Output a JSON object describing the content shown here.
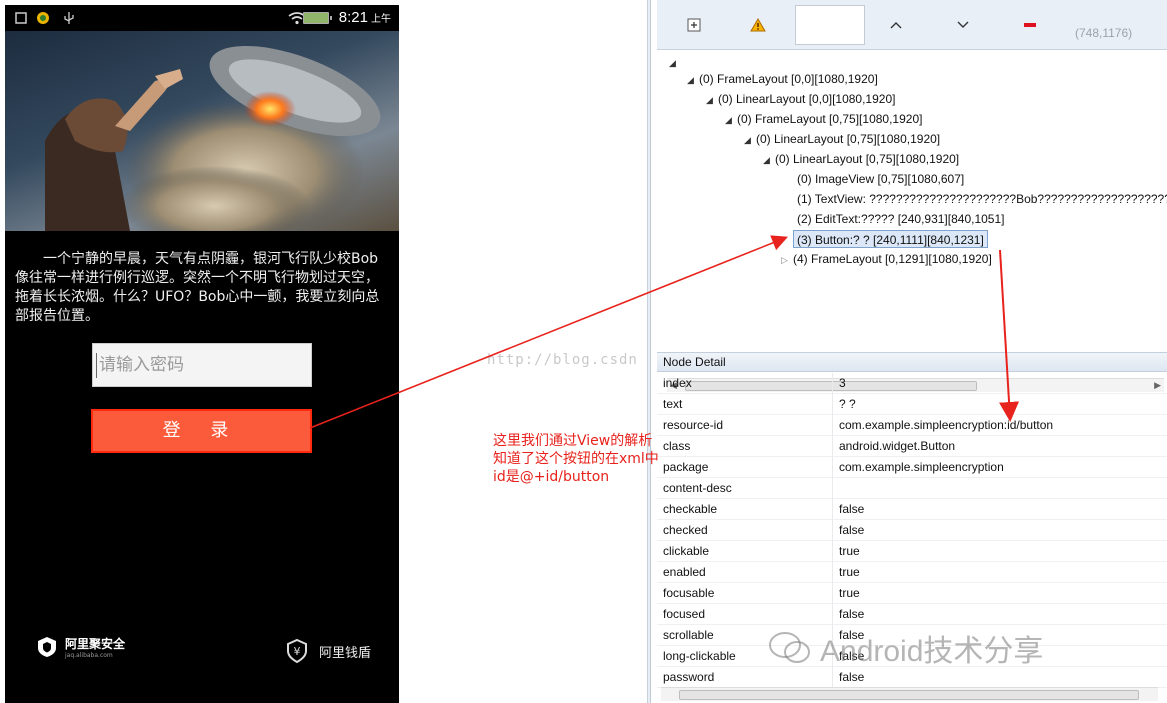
{
  "phone": {
    "status": {
      "time": "8:21",
      "ampm": "上午"
    },
    "story": "一个宁静的早晨，天气有点阴霾，银河飞行队少校Bob像往常一样进行例行巡逻。突然一个不明飞行物划过天空，拖着长长浓烟。什么？UFO？Bob心中一颤，我要立刻向总部报告位置。",
    "password_placeholder": "请输入密码",
    "login_label": "登 录",
    "footer_left": "阿里聚安全",
    "footer_left_sub": "jaq.alibaba.com",
    "footer_right": "阿里钱盾"
  },
  "annotation": {
    "watermark_url": "http://blog.csdn",
    "note_line1": "这里我们通过View的解析",
    "note_line2": "知道了这个按钮的在xml中",
    "note_line3": "id是@+id/button",
    "color": "#e8221c"
  },
  "toolbar": {
    "coords": "(748,1176)"
  },
  "tree": {
    "root_label": "",
    "nodes": [
      {
        "label": "(0) FrameLayout [0,0][1080,1920]"
      },
      {
        "label": "(0) LinearLayout [0,0][1080,1920]"
      },
      {
        "label": "(0) FrameLayout [0,75][1080,1920]"
      },
      {
        "label": "(0) LinearLayout [0,75][1080,1920]"
      },
      {
        "label": "(0) LinearLayout [0,75][1080,1920]"
      },
      {
        "label": "(0) ImageView [0,75][1080,607]"
      },
      {
        "label": "(1) TextView:     ??????????????????????Bob??????????????????????"
      },
      {
        "label": "(2) EditText:????? [240,931][840,1051]"
      },
      {
        "label": "(3) Button:?    ? [240,1111][840,1231]"
      },
      {
        "label": "(4) FrameLayout [0,1291][1080,1920]"
      }
    ]
  },
  "detail": {
    "title": "Node Detail",
    "rows": [
      {
        "key": "index",
        "value": "3"
      },
      {
        "key": "text",
        "value": "?   ?"
      },
      {
        "key": "resource-id",
        "value": "com.example.simpleencryption:id/button"
      },
      {
        "key": "class",
        "value": "android.widget.Button"
      },
      {
        "key": "package",
        "value": "com.example.simpleencryption"
      },
      {
        "key": "content-desc",
        "value": ""
      },
      {
        "key": "checkable",
        "value": "false"
      },
      {
        "key": "checked",
        "value": "false"
      },
      {
        "key": "clickable",
        "value": "true"
      },
      {
        "key": "enabled",
        "value": "true"
      },
      {
        "key": "focusable",
        "value": "true"
      },
      {
        "key": "focused",
        "value": "false"
      },
      {
        "key": "scrollable",
        "value": "false"
      },
      {
        "key": "long-clickable",
        "value": "false"
      },
      {
        "key": "password",
        "value": "false"
      }
    ]
  },
  "watermark": {
    "text": "Android技术分享"
  },
  "colors": {
    "login_button": "#fb5b3b",
    "selection": "#dce8f7",
    "toolbar": "#e9eff6"
  }
}
